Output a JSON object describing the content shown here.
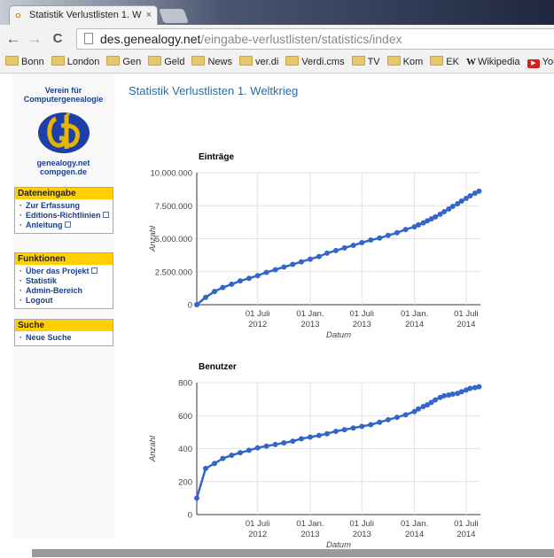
{
  "tab": {
    "title": "Statistik Verlustlisten 1. W",
    "close": "×"
  },
  "toolbar": {
    "back": "←",
    "forward": "→",
    "reload": "C",
    "url_host": "des.genealogy.net",
    "url_path": "/eingabe-verlustlisten/statistics/index"
  },
  "bookmarks": [
    {
      "label": "Bonn",
      "icon": "folder"
    },
    {
      "label": "London",
      "icon": "folder"
    },
    {
      "label": "Gen",
      "icon": "folder"
    },
    {
      "label": "Geld",
      "icon": "folder"
    },
    {
      "label": "News",
      "icon": "folder"
    },
    {
      "label": "ver.di",
      "icon": "folder"
    },
    {
      "label": "Verdi.cms",
      "icon": "folder"
    },
    {
      "label": "TV",
      "icon": "folder"
    },
    {
      "label": "Kom",
      "icon": "folder"
    },
    {
      "label": "EK",
      "icon": "folder"
    },
    {
      "label": "Wikipedia",
      "icon": "wikipedia"
    },
    {
      "label": "YouTube",
      "icon": "youtube"
    }
  ],
  "sidebar": {
    "org_line1": "Verein für",
    "org_line2": "Computergenealogie",
    "site1": "genealogy.net",
    "site2": "compgen.de",
    "sections": [
      {
        "title": "Dateneingabe",
        "items": [
          {
            "label": "Zur Erfassung",
            "external": false
          },
          {
            "label": "Editions-Richtlinien",
            "external": true
          },
          {
            "label": "Anleitung",
            "external": true
          }
        ]
      },
      {
        "title": "Funktionen",
        "items": [
          {
            "label": "Über das Projekt",
            "external": true
          },
          {
            "label": "Statistik",
            "external": false
          },
          {
            "label": "Admin-Bereich",
            "external": false
          },
          {
            "label": "Logout",
            "external": false
          }
        ]
      },
      {
        "title": "Suche",
        "items": [
          {
            "label": "Neue Suche",
            "external": false
          }
        ]
      }
    ]
  },
  "page_title": "Statistik Verlustlisten 1. Weltkrieg",
  "chart_data": [
    {
      "type": "line",
      "title": "Einträge",
      "xlabel": "Datum",
      "ylabel": "Anzahl",
      "ylim": [
        0,
        10000000
      ],
      "yticks": [
        "0",
        "2.500.000",
        "5.000.000",
        "7.500.000",
        "10.000.000"
      ],
      "xticks": [
        [
          "01 Juli",
          "2012"
        ],
        [
          "01 Jan.",
          "2013"
        ],
        [
          "01 Juli",
          "2013"
        ],
        [
          "01 Jan.",
          "2014"
        ],
        [
          "01 Juli",
          "2014"
        ]
      ],
      "xlim": [
        "2011-12-01",
        "2014-08-20"
      ],
      "color": "#3366cc",
      "series": [
        {
          "points": [
            [
              "2011-12-01",
              0
            ],
            [
              "2012-01-01",
              550000
            ],
            [
              "2012-02-01",
              1000000
            ],
            [
              "2012-03-01",
              1300000
            ],
            [
              "2012-04-01",
              1550000
            ],
            [
              "2012-05-01",
              1800000
            ],
            [
              "2012-06-01",
              2000000
            ],
            [
              "2012-07-01",
              2200000
            ],
            [
              "2012-08-01",
              2450000
            ],
            [
              "2012-09-01",
              2650000
            ],
            [
              "2012-10-01",
              2850000
            ],
            [
              "2012-11-01",
              3050000
            ],
            [
              "2012-12-01",
              3250000
            ],
            [
              "2013-01-01",
              3450000
            ],
            [
              "2013-02-01",
              3650000
            ],
            [
              "2013-03-01",
              3900000
            ],
            [
              "2013-04-01",
              4100000
            ],
            [
              "2013-05-01",
              4300000
            ],
            [
              "2013-06-01",
              4500000
            ],
            [
              "2013-07-01",
              4700000
            ],
            [
              "2013-08-01",
              4900000
            ],
            [
              "2013-09-01",
              5050000
            ],
            [
              "2013-10-01",
              5250000
            ],
            [
              "2013-11-01",
              5450000
            ],
            [
              "2013-12-01",
              5700000
            ],
            [
              "2014-01-01",
              5900000
            ],
            [
              "2014-01-15",
              6050000
            ],
            [
              "2014-02-01",
              6200000
            ],
            [
              "2014-02-15",
              6350000
            ],
            [
              "2014-03-01",
              6500000
            ],
            [
              "2014-03-15",
              6650000
            ],
            [
              "2014-04-01",
              6850000
            ],
            [
              "2014-04-15",
              7050000
            ],
            [
              "2014-05-01",
              7250000
            ],
            [
              "2014-05-15",
              7450000
            ],
            [
              "2014-06-01",
              7650000
            ],
            [
              "2014-06-15",
              7850000
            ],
            [
              "2014-07-01",
              8050000
            ],
            [
              "2014-07-15",
              8250000
            ],
            [
              "2014-08-01",
              8450000
            ],
            [
              "2014-08-15",
              8600000
            ]
          ]
        }
      ]
    },
    {
      "type": "line",
      "title": "Benutzer",
      "xlabel": "Datum",
      "ylabel": "Anzahl",
      "ylim": [
        0,
        800
      ],
      "yticks": [
        "0",
        "200",
        "400",
        "600",
        "800"
      ],
      "xticks": [
        [
          "01 Juli",
          "2012"
        ],
        [
          "01 Jan.",
          "2013"
        ],
        [
          "01 Juli",
          "2013"
        ],
        [
          "01 Jan.",
          "2014"
        ],
        [
          "01 Juli",
          "2014"
        ]
      ],
      "xlim": [
        "2011-12-01",
        "2014-08-20"
      ],
      "color": "#3366cc",
      "series": [
        {
          "points": [
            [
              "2011-12-01",
              100
            ],
            [
              "2012-01-01",
              280
            ],
            [
              "2012-02-01",
              310
            ],
            [
              "2012-03-01",
              340
            ],
            [
              "2012-04-01",
              360
            ],
            [
              "2012-05-01",
              375
            ],
            [
              "2012-06-01",
              390
            ],
            [
              "2012-07-01",
              405
            ],
            [
              "2012-08-01",
              415
            ],
            [
              "2012-09-01",
              425
            ],
            [
              "2012-10-01",
              435
            ],
            [
              "2012-11-01",
              445
            ],
            [
              "2012-12-01",
              460
            ],
            [
              "2013-01-01",
              470
            ],
            [
              "2013-02-01",
              480
            ],
            [
              "2013-03-01",
              490
            ],
            [
              "2013-04-01",
              505
            ],
            [
              "2013-05-01",
              515
            ],
            [
              "2013-06-01",
              525
            ],
            [
              "2013-07-01",
              535
            ],
            [
              "2013-08-01",
              545
            ],
            [
              "2013-09-01",
              560
            ],
            [
              "2013-10-01",
              575
            ],
            [
              "2013-11-01",
              590
            ],
            [
              "2013-12-01",
              605
            ],
            [
              "2014-01-01",
              625
            ],
            [
              "2014-01-15",
              640
            ],
            [
              "2014-02-01",
              655
            ],
            [
              "2014-02-15",
              665
            ],
            [
              "2014-03-01",
              680
            ],
            [
              "2014-03-15",
              695
            ],
            [
              "2014-04-01",
              710
            ],
            [
              "2014-04-15",
              720
            ],
            [
              "2014-05-01",
              725
            ],
            [
              "2014-05-15",
              730
            ],
            [
              "2014-06-01",
              735
            ],
            [
              "2014-06-15",
              745
            ],
            [
              "2014-07-01",
              755
            ],
            [
              "2014-07-15",
              765
            ],
            [
              "2014-08-01",
              770
            ],
            [
              "2014-08-15",
              775
            ]
          ]
        }
      ]
    }
  ]
}
